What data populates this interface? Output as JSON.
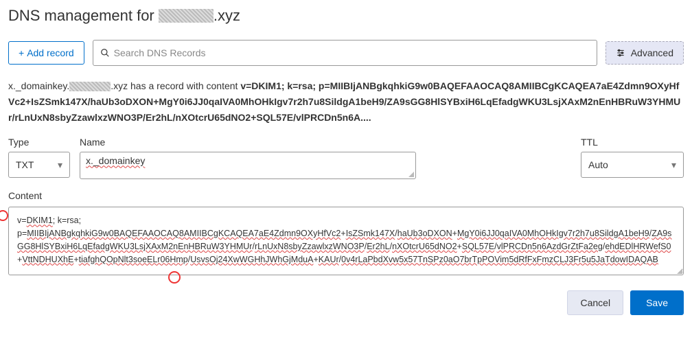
{
  "page": {
    "title_prefix": "DNS management for ",
    "title_suffix": ".xyz"
  },
  "toolbar": {
    "add_label": "Add record",
    "search_placeholder": "Search DNS Records",
    "advanced_label": "Advanced"
  },
  "summary": {
    "host_suffix": ".xyz",
    "lead_prefix": "x._domainkey.",
    "lead_mid": " has a record with content ",
    "content_bold": "v=DKIM1; k=rsa; p=MIIBIjANBgkqhkiG9w0BAQEFAAOCAQ8AMIIBCgKCAQEA7aE4Zdmn9OXyHfVc2+IsZSmk147X/haUb3oDXON+MgY0i6JJ0qaIVA0MhOHkIgv7r2h7u8SildgA1beH9/ZA9sGG8HlSYBxiH6LqEfadgWKU3LsjXAxM2nEnHBRuW3YHMUr/rLnUxN8sbyZzawlxzWNO3P/Er2hL/nXOtcrU65dNO2+SQL57E/vlPRCDn5n6A...."
  },
  "fields": {
    "type_label": "Type",
    "type_value": "TXT",
    "name_label": "Name",
    "name_value": "x._domainkey",
    "ttl_label": "TTL",
    "ttl_value": "Auto",
    "content_label": "Content"
  },
  "content_segments": {
    "s0": "v=",
    "s1": "DKIM1",
    "s2": "; k=rsa;",
    "s3": "p=",
    "s4": "MIIBIjANBgkqhkiG9w0BAQEFAAOCAQ8AMIIBCgKCAQEA7aE4Zdmn9OXyHfVc2",
    "s5": "+",
    "s6": "IsZSmk147X",
    "s7": "/",
    "s8": "haUb3oDXON",
    "s9": "+",
    "s10": "MgY0i6JJ0qaIVA0MhOHkIgv7r2h7u8SildgA1beH9",
    "s11": "/",
    "s12": "ZA9sGG8HlSYBxiH6LqEfadgWKU3LsjXAxM2nEnHBRuW3YHMUr",
    "s13": "/",
    "s14": "rLnUxN8sbyZzawlxzWNO3P",
    "s15": "/",
    "s16": "Er2hL",
    "s17": "/",
    "s18": "nXOtcrU65dNO2",
    "s19": "+",
    "s20": "SQL57E",
    "s21": "/",
    "s22": "vlPRCDn5n6AzdGrZtFa2eg",
    "s23": "/",
    "s24": "ehdEDlHRWefS0",
    "s25": "+",
    "s26": "VttNDHUXhE",
    "s27": "+",
    "s28": "tiafghQOpNlt3soeELr06Hmp",
    "s29": "/",
    "s30": "UsvsOj24XwWGHhJWhGjMduA",
    "s31": "+",
    "s32": "KAUr",
    "s33": "/",
    "s34": "0v4rLaPbdXvw5x57TnSPz0aO7brTpPOVim5dRfFxFmzCLJ3Fr5u5JaTdowIDAQAB"
  },
  "footer": {
    "cancel": "Cancel",
    "save": "Save"
  }
}
